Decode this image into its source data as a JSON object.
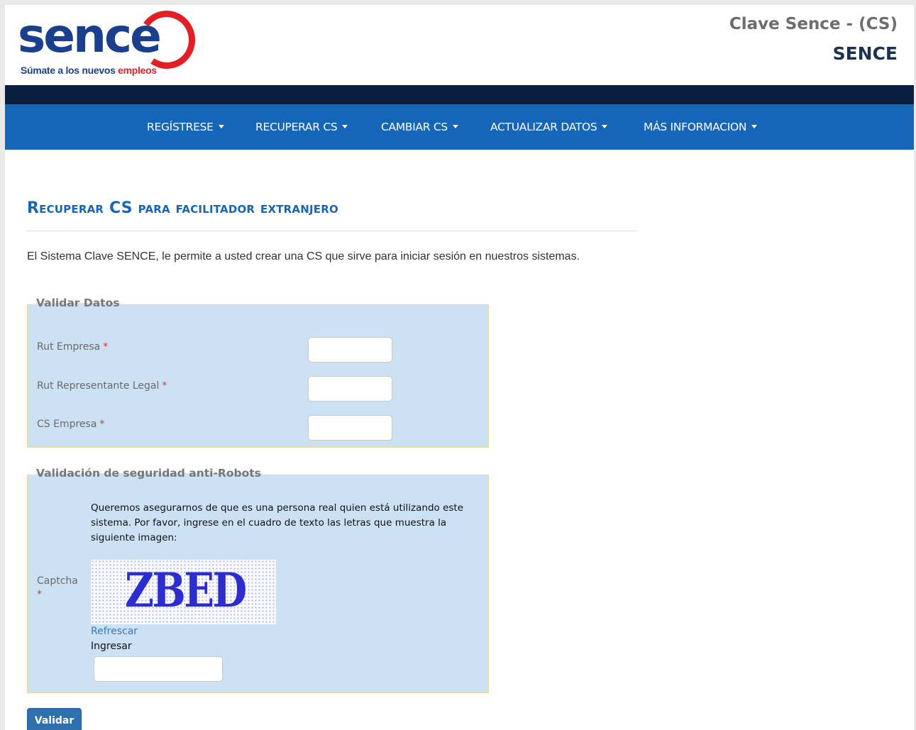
{
  "colors": {
    "nav_blue": "#1565b8",
    "dark_bar": "#0a1f3f",
    "panel_bg": "#cde1f4",
    "brand_red": "#e31e24",
    "brand_blue": "#1a3f8c"
  },
  "logo": {
    "wordmark": "sence",
    "tagline_start": "Súmate a los nuevos ",
    "tagline_highlight": "empleos"
  },
  "header": {
    "title_line1": "Clave Sence - (CS)",
    "title_line2": "SENCE"
  },
  "nav": {
    "items": [
      {
        "label": "REGÍSTRESE",
        "icon": "caret-down-icon"
      },
      {
        "label": "RECUPERAR CS",
        "icon": "caret-down-icon"
      },
      {
        "label": "CAMBIAR CS",
        "icon": "caret-down-icon"
      },
      {
        "label": "ACTUALIZAR DATOS",
        "icon": "caret-down-icon"
      },
      {
        "label": "MÁS INFORMACION",
        "icon": "caret-down-icon"
      }
    ]
  },
  "main": {
    "heading": "Recuperar CS para facilitador extranjero",
    "intro": "El Sistema Clave SENCE, le permite a usted crear una CS que sirve para iniciar sesión en nuestros sistemas."
  },
  "validar_datos": {
    "legend": "Validar Datos",
    "required_mark": "*",
    "fields": [
      {
        "label": "Rut Empresa",
        "value": ""
      },
      {
        "label": "Rut Representante Legal",
        "value": ""
      },
      {
        "label": "CS Empresa",
        "value": ""
      }
    ]
  },
  "captcha": {
    "legend": "Validación de seguridad anti-Robots",
    "description": "Queremos asegurarnos de que es una persona real quien está utilizando este sistema. Por favor, ingrese en el cuadro de texto las letras que muestra la siguiente imagen:",
    "label": "Captcha",
    "required_mark": "*",
    "image_text": "ZBED",
    "refresh_label": "Refrescar",
    "input_label": "Ingresar",
    "input_value": ""
  },
  "submit": {
    "label": "Validar"
  }
}
